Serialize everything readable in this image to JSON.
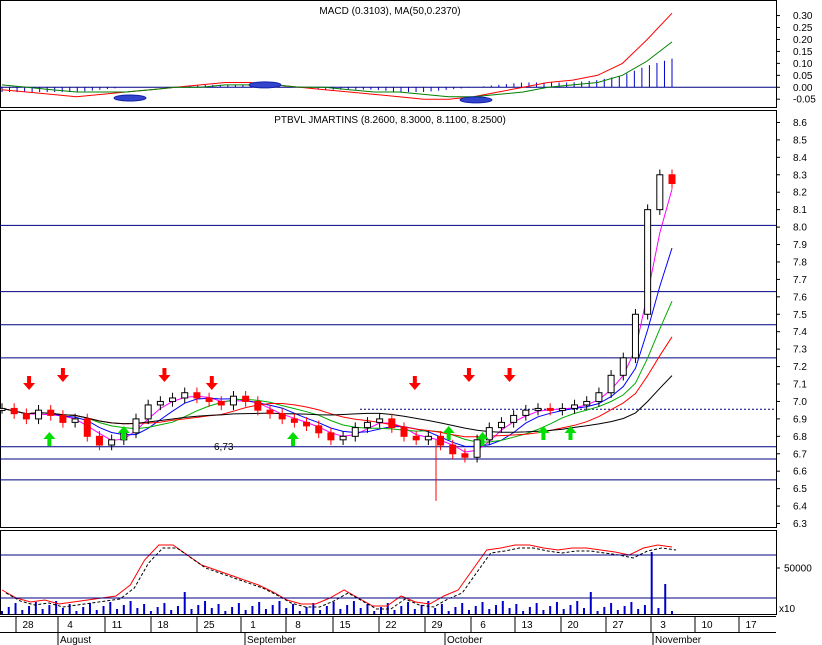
{
  "chart_data": [
    {
      "type": "line",
      "panel": "macd",
      "title": "MACD (0.3103), MA(50,0.2370)",
      "ylim": [
        -0.07,
        0.34
      ],
      "y_ticks": [
        "0.30",
        "0.25",
        "0.20",
        "0.15",
        "0.10",
        "0.05",
        "0.00",
        "-0.05"
      ],
      "y_tick_values": [
        0.3,
        0.25,
        0.2,
        0.15,
        0.1,
        0.05,
        0.0,
        -0.05
      ],
      "series": [
        {
          "color": "#ff0000",
          "values": [
            -0.01,
            -0.02,
            -0.03,
            -0.04,
            -0.03,
            -0.02,
            -0.01,
            0.0,
            0.01,
            0.02,
            0.02,
            0.01,
            0.0,
            -0.01,
            -0.02,
            -0.03,
            -0.04,
            -0.05,
            -0.05,
            -0.04,
            -0.02,
            0.0,
            0.02,
            0.03,
            0.05,
            0.1,
            0.2,
            0.31
          ]
        },
        {
          "color": "#008000",
          "values": [
            0.01,
            0.0,
            -0.01,
            -0.02,
            -0.02,
            -0.02,
            -0.01,
            0.0,
            0.0,
            0.01,
            0.01,
            0.01,
            0.0,
            0.0,
            -0.01,
            -0.02,
            -0.02,
            -0.03,
            -0.04,
            -0.04,
            -0.03,
            -0.02,
            0.0,
            0.01,
            0.02,
            0.05,
            0.11,
            0.19
          ]
        }
      ]
    },
    {
      "type": "candlestick",
      "panel": "price",
      "title": "PTBVL JMARTINS (8.2600, 8.3000, 8.1100, 8.2500)",
      "ylim": [
        6.28,
        8.66
      ],
      "y_ticks": [
        "8.6",
        "8.5",
        "8.4",
        "8.3",
        "8.2",
        "8.1",
        "8.0",
        "7.9",
        "7.8",
        "7.7",
        "7.6",
        "7.5",
        "7.4",
        "7.3",
        "7.2",
        "7.1",
        "7.0",
        "6.9",
        "6.8",
        "6.7",
        "6.6",
        "6.5",
        "6.4",
        "6.3"
      ],
      "y_tick_values": [
        8.6,
        8.5,
        8.4,
        8.3,
        8.2,
        8.1,
        8.0,
        7.9,
        7.8,
        7.7,
        7.6,
        7.5,
        7.4,
        7.3,
        7.2,
        7.1,
        7.0,
        6.9,
        6.8,
        6.7,
        6.6,
        6.5,
        6.4,
        6.3
      ],
      "horizontal_lines": [
        8.01,
        7.63,
        7.44,
        7.25,
        6.74,
        6.67,
        6.55
      ],
      "dashed_line": 6.955,
      "annotation": "6,73",
      "closes": [
        6.96,
        6.93,
        6.9,
        6.95,
        6.92,
        6.88,
        6.9,
        6.8,
        6.75,
        6.78,
        6.82,
        6.9,
        6.98,
        7.0,
        7.02,
        7.05,
        7.02,
        7.0,
        6.98,
        7.03,
        7.0,
        6.95,
        6.93,
        6.9,
        6.88,
        6.86,
        6.82,
        6.78,
        6.8,
        6.85,
        6.88,
        6.9,
        6.85,
        6.8,
        6.78,
        6.8,
        6.75,
        6.7,
        6.68,
        6.78,
        6.85,
        6.88,
        6.92,
        6.95,
        6.96,
        6.95,
        6.96,
        6.98,
        7.0,
        7.05,
        7.15,
        7.25,
        7.5,
        8.1,
        8.3,
        8.25
      ],
      "arrows_down": [
        4,
        9,
        24,
        31,
        61,
        69,
        75
      ],
      "arrows_up": [
        7,
        18,
        43,
        66,
        71,
        80,
        84
      ]
    },
    {
      "type": "line",
      "panel": "stochastic_volume",
      "y_ticks": [
        "50000"
      ],
      "y_tick_values": [
        50000
      ],
      "scale_note": "x10",
      "x_labels": [
        "28",
        "4",
        "11",
        "18",
        "25",
        "1",
        "8",
        "15",
        "22",
        "29",
        "6",
        "13",
        "20",
        "27",
        "3",
        "10",
        "17"
      ],
      "month_labels": [
        "August",
        "September",
        "October",
        "November"
      ]
    }
  ]
}
